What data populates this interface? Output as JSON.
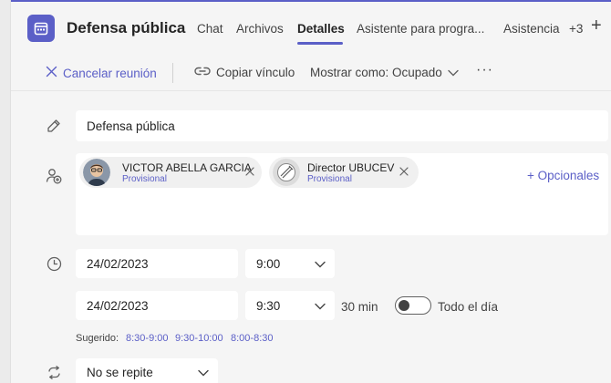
{
  "header": {
    "title": "Defensa pública",
    "tabs": [
      {
        "label": "Chat"
      },
      {
        "label": "Archivos"
      },
      {
        "label": "Detalles"
      },
      {
        "label": "Asistente para progra..."
      },
      {
        "label": "Asistencia"
      }
    ],
    "more_tabs": "+3",
    "add_tab": "+"
  },
  "toolbar": {
    "cancel_label": "Cancelar reunión",
    "copy_label": "Copiar vínculo",
    "show_as_label": "Mostrar como: Ocupado",
    "overflow_label": "···"
  },
  "form": {
    "title_value": "Defensa pública",
    "attendees": [
      {
        "name": "VICTOR ABELLA GARCIA",
        "status": "Provisional"
      },
      {
        "name": "Director UBUCEV",
        "status": "Provisional"
      }
    ],
    "optional_label": "+ Opcionales",
    "start": {
      "date": "24/02/2023",
      "time": "9:00"
    },
    "end": {
      "date": "24/02/2023",
      "time": "9:30"
    },
    "duration": "30 min",
    "all_day_label": "Todo el día",
    "all_day_on": false,
    "suggested_label": "Sugerido:",
    "suggested": [
      "8:30-9:00",
      "9:30-10:00",
      "8:00-8:30"
    ],
    "repeat_value": "No se repite"
  },
  "colors": {
    "accent": "#5b5fc7",
    "background": "#f5f5f5",
    "field": "#ffffff"
  },
  "icons": {
    "app": "calendar-icon",
    "cancel": "close-icon",
    "copy": "link-icon",
    "show_as": "chevron-down-icon",
    "title_row": "pencil-icon",
    "attendees_row": "person-add-icon",
    "time_row": "clock-icon",
    "repeat_row": "repeat-icon"
  }
}
